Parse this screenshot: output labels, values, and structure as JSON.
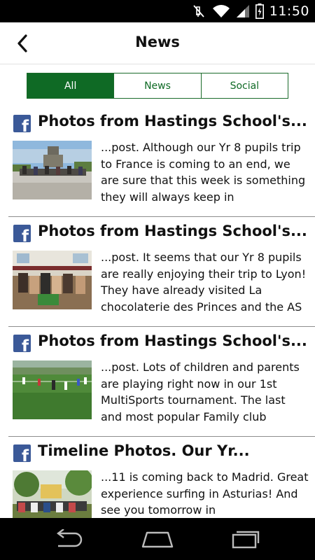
{
  "status_bar": {
    "time": "11:50",
    "icons": [
      "mute-icon",
      "wifi-icon",
      "signal-icon",
      "battery-icon"
    ]
  },
  "header": {
    "title": "News",
    "back_icon": "back-chevron-icon"
  },
  "tabs": [
    {
      "label": "All",
      "active": true
    },
    {
      "label": "News",
      "active": false
    },
    {
      "label": "Social",
      "active": false
    }
  ],
  "posts": [
    {
      "source_icon": "facebook-icon",
      "title": "Photos from Hastings School's...",
      "text": "...post. Although our Yr 8 pupils trip to France is coming to an end, we are sure that this week is something they will always keep in"
    },
    {
      "source_icon": "facebook-icon",
      "title": "Photos from Hastings School's...",
      "text": "...post. It seems that our Yr 8 pupils are really enjoying their trip to Lyon! They have already visited La chocolaterie des Princes and the AS"
    },
    {
      "source_icon": "facebook-icon",
      "title": "Photos from Hastings School's...",
      "text": "...post. Lots of children and parents are playing right now in our 1st MultiSports tournament. The last and most popular Family club"
    },
    {
      "source_icon": "facebook-icon",
      "title": "Timeline Photos. Our Yr...",
      "text": "...11 is coming back to Madrid. Great experience surfing in Asturias! And see you tomorrow in"
    }
  ],
  "nav_bar": {
    "icons": [
      "back-nav-icon",
      "home-nav-icon",
      "recents-nav-icon"
    ]
  },
  "colors": {
    "accent": "#0f6a25",
    "facebook": "#3b5998",
    "status_bar": "#000000"
  }
}
